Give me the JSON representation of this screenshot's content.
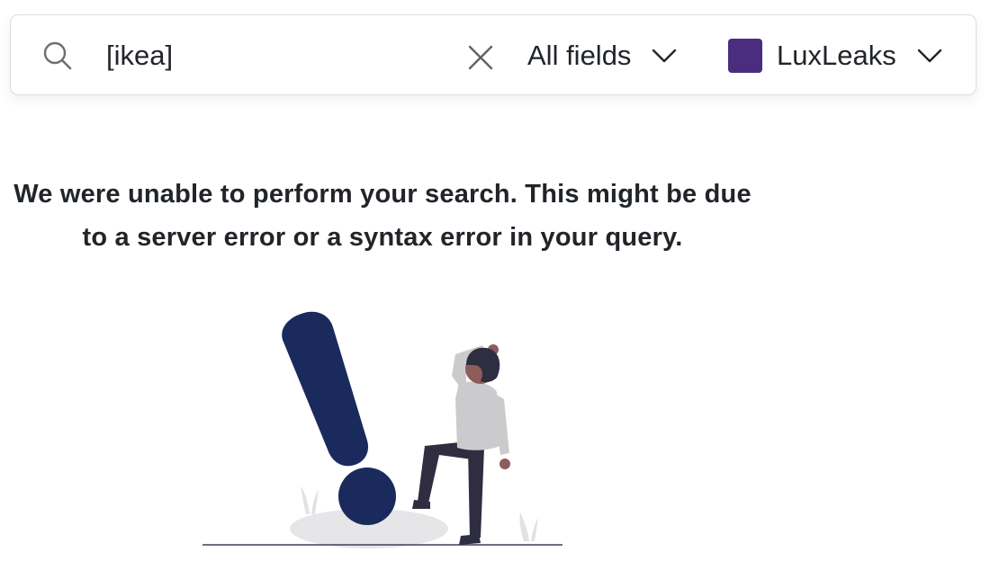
{
  "search": {
    "query": "[ikea]",
    "fields_label": "All fields",
    "dataset_label": "LuxLeaks",
    "dataset_color": "#4a2d7f"
  },
  "icons": {
    "search": "search-icon",
    "clear": "close-icon",
    "fields_dropdown": "chevron-down-icon",
    "dataset_dropdown": "chevron-down-icon"
  },
  "error": {
    "message": "We were unable to perform your search. This might be due to a server error or a syntax error in your query."
  },
  "illustration": {
    "name": "error-illustration",
    "accent_color": "#1a2a5c"
  }
}
